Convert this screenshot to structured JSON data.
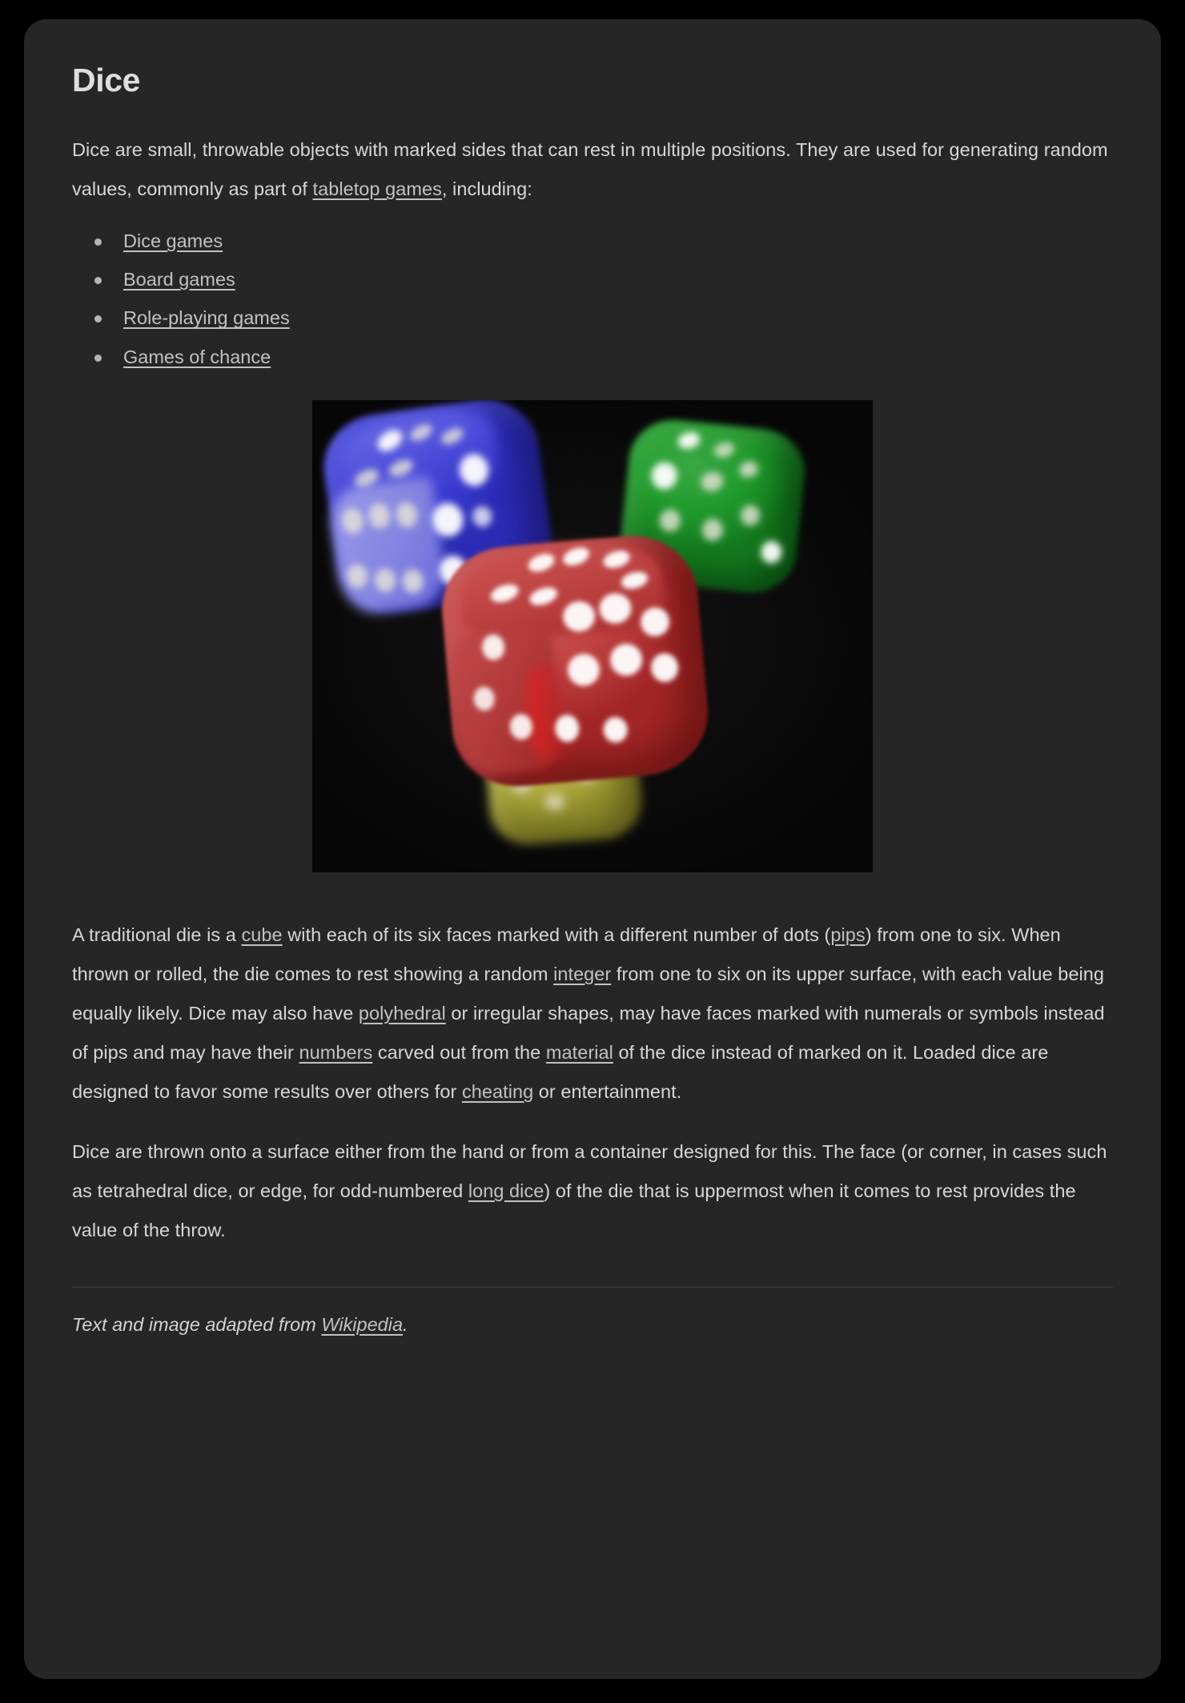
{
  "article": {
    "title": "Dice",
    "intro": {
      "before_link": "Dice are small, throwable objects with marked sides that can rest in multiple positions. They are used for generating random values, commonly as part of ",
      "link": "tabletop games",
      "after_link": ", including:"
    },
    "list": [
      {
        "label": "Dice games"
      },
      {
        "label": "Board games"
      },
      {
        "label": "Role-playing games"
      },
      {
        "label": "Games of chance"
      }
    ],
    "figure": {
      "alt": "Four blurred dice: blue, green, red and yellow on a black background",
      "dice": [
        {
          "color_name": "blue",
          "hex": "#3b3bd4"
        },
        {
          "color_name": "green",
          "hex": "#209a2c"
        },
        {
          "color_name": "red",
          "hex": "#c04141"
        },
        {
          "color_name": "yellow",
          "hex": "#b3ae3f"
        }
      ]
    },
    "paragraph_2": {
      "s1": "A traditional die is a ",
      "l1": "cube",
      "s2": " with each of its six faces marked with a different number of dots (",
      "l2": "pips",
      "s3": ") from one to six. When thrown or rolled, the die comes to rest showing a random ",
      "l3": "integer",
      "s4": " from one to six on its upper surface, with each value being equally likely. Dice may also have ",
      "l4": "polyhedral",
      "s5": " or irregular shapes, may have faces marked with numerals or symbols instead of pips and may have their ",
      "l5": "numbers",
      "s6": " carved out from the ",
      "l6": "material",
      "s7": " of the dice instead of marked on it. Loaded dice are designed to favor some results over others for ",
      "l7": "cheating",
      "s8": " or entertainment."
    },
    "paragraph_3": {
      "s1": "Dice are thrown onto a surface either from the hand or from a container designed for this. The face (or corner, in cases such as tetrahedral dice, or edge, for odd-numbered ",
      "l1": "long dice",
      "s2": ") of the die that is uppermost when it comes to rest provides the value of the throw."
    },
    "footer": {
      "s1": "Text and image adapted from ",
      "l1": "Wikipedia",
      "s2": "."
    }
  },
  "colors": {
    "page_background": "#000000",
    "card_background": "#262626",
    "body_text": "#d7d7d7",
    "link_text": "#c2c2c2",
    "divider": "#3d3d3d"
  }
}
